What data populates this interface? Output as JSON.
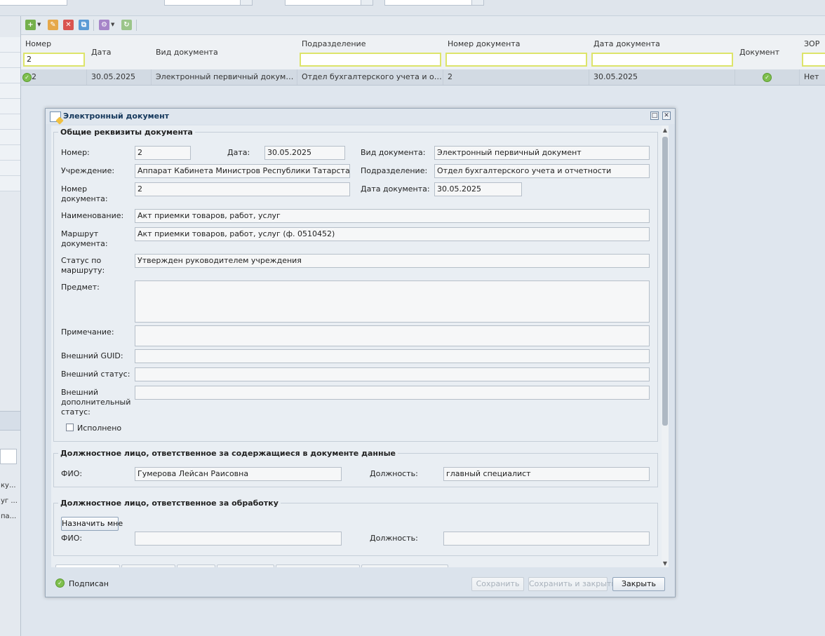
{
  "grid": {
    "columns": [
      {
        "key": "nomer",
        "label": "Номер",
        "filter": "2"
      },
      {
        "key": "data",
        "label": "Дата"
      },
      {
        "key": "vid",
        "label": "Вид документа"
      },
      {
        "key": "podr",
        "label": "Подразделение",
        "filter": ""
      },
      {
        "key": "nomdoc",
        "label": "Номер документа",
        "filter": ""
      },
      {
        "key": "datadoc",
        "label": "Дата документа",
        "filter": ""
      },
      {
        "key": "doc",
        "label": "Документ"
      },
      {
        "key": "zor",
        "label": "ЗОР",
        "filter": ""
      }
    ],
    "row": {
      "nomer": "2",
      "data": "30.05.2025",
      "vid": "Электронный первичный документ",
      "podr": "Отдел бухгалтерского учета и отчет...",
      "nomdoc": "2",
      "datadoc": "30.05.2025",
      "zor": "Нет"
    }
  },
  "left_panel": {
    "rows": [
      "ку...",
      "уг ...",
      "па..."
    ]
  },
  "window": {
    "title": "Электронный документ",
    "general": {
      "legend": "Общие реквизиты документа",
      "nomer_label": "Номер:",
      "nomer": "2",
      "data_label": "Дата:",
      "data": "30.05.2025",
      "vid_label": "Вид документа:",
      "vid": "Электронный первичный документ",
      "uchr_label": "Учреждение:",
      "uchr": "Аппарат Кабинета Министров Республики Татарстан",
      "podr_label": "Подразделение:",
      "podr": "Отдел бухгалтерского учета и отчетности",
      "nomdoc_label": "Номер документа:",
      "nomdoc": "2",
      "datadoc_label": "Дата документа:",
      "datadoc": "30.05.2025",
      "naim_label": "Наименование:",
      "naim": "Акт приемки товаров, работ, услуг",
      "marsh_label": "Маршрут документа:",
      "marsh": "Акт приемки товаров, работ, услуг (ф. 0510452)",
      "status_label": "Статус по маршруту:",
      "status": "Утвержден руководителем учреждения",
      "predmet_label": "Предмет:",
      "predmet": "",
      "prim_label": "Примечание:",
      "prim": "",
      "guid_label": "Внешний GUID:",
      "guid": "",
      "extstatus_label": "Внешний статус:",
      "extstatus": "",
      "extdop_label": "Внешний дополнительный статус:",
      "extdop": "",
      "ispolneno_label": "Исполнено"
    },
    "resp_data": {
      "legend": "Должностное лицо, ответственное за содержащиеся в документе данные",
      "fio_label": "ФИО:",
      "fio": "Гумерова Лейсан Раисовна",
      "dolzh_label": "Должность:",
      "dolzh": "главный специалист"
    },
    "resp_proc": {
      "legend": "Должностное лицо, ответственное за обработку",
      "assign_button": "Назначить мне",
      "fio_label": "ФИО:",
      "fio": "",
      "dolzh_label": "Должность:",
      "dolzh": ""
    },
    "footer": {
      "status": "Подписан",
      "save": "Сохранить",
      "save_close": "Сохранить и закрыть",
      "close": "Закрыть"
    }
  }
}
